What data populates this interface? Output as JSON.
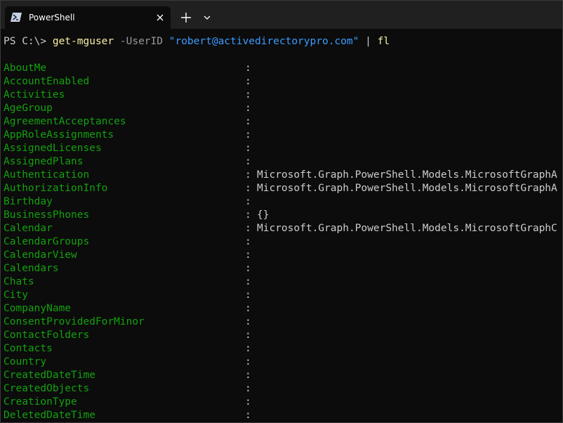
{
  "tab": {
    "title": "PowerShell",
    "icon": "powershell-icon",
    "close_icon": "close-icon"
  },
  "toolbar": {
    "new_tab_icon": "plus-icon",
    "dropdown_icon": "chevron-down-icon"
  },
  "command": {
    "prompt": "PS C:\\>",
    "cmdlet": "get-mguser",
    "parameter": "-UserID",
    "argument": "\"robert@activedirectorypro.com\"",
    "pipe": "|",
    "formatter": "fl"
  },
  "separator": ":",
  "properties": [
    {
      "name": "AboutMe",
      "value": ""
    },
    {
      "name": "AccountEnabled",
      "value": ""
    },
    {
      "name": "Activities",
      "value": ""
    },
    {
      "name": "AgeGroup",
      "value": ""
    },
    {
      "name": "AgreementAcceptances",
      "value": ""
    },
    {
      "name": "AppRoleAssignments",
      "value": ""
    },
    {
      "name": "AssignedLicenses",
      "value": ""
    },
    {
      "name": "AssignedPlans",
      "value": ""
    },
    {
      "name": "Authentication",
      "value": "Microsoft.Graph.PowerShell.Models.MicrosoftGraphA"
    },
    {
      "name": "AuthorizationInfo",
      "value": "Microsoft.Graph.PowerShell.Models.MicrosoftGraphA"
    },
    {
      "name": "Birthday",
      "value": ""
    },
    {
      "name": "BusinessPhones",
      "value": "{}"
    },
    {
      "name": "Calendar",
      "value": "Microsoft.Graph.PowerShell.Models.MicrosoftGraphC"
    },
    {
      "name": "CalendarGroups",
      "value": ""
    },
    {
      "name": "CalendarView",
      "value": ""
    },
    {
      "name": "Calendars",
      "value": ""
    },
    {
      "name": "Chats",
      "value": ""
    },
    {
      "name": "City",
      "value": ""
    },
    {
      "name": "CompanyName",
      "value": ""
    },
    {
      "name": "ConsentProvidedForMinor",
      "value": ""
    },
    {
      "name": "ContactFolders",
      "value": ""
    },
    {
      "name": "Contacts",
      "value": ""
    },
    {
      "name": "Country",
      "value": ""
    },
    {
      "name": "CreatedDateTime",
      "value": ""
    },
    {
      "name": "CreatedObjects",
      "value": ""
    },
    {
      "name": "CreationType",
      "value": ""
    },
    {
      "name": "DeletedDateTime",
      "value": ""
    }
  ],
  "colors": {
    "background": "#0c0c0c",
    "titlebar": "#202020",
    "property_name": "#13a10e",
    "cmdlet": "#f9f1a5",
    "string": "#3b9cff",
    "parameter": "#9a9a9a",
    "text": "#cccccc"
  }
}
